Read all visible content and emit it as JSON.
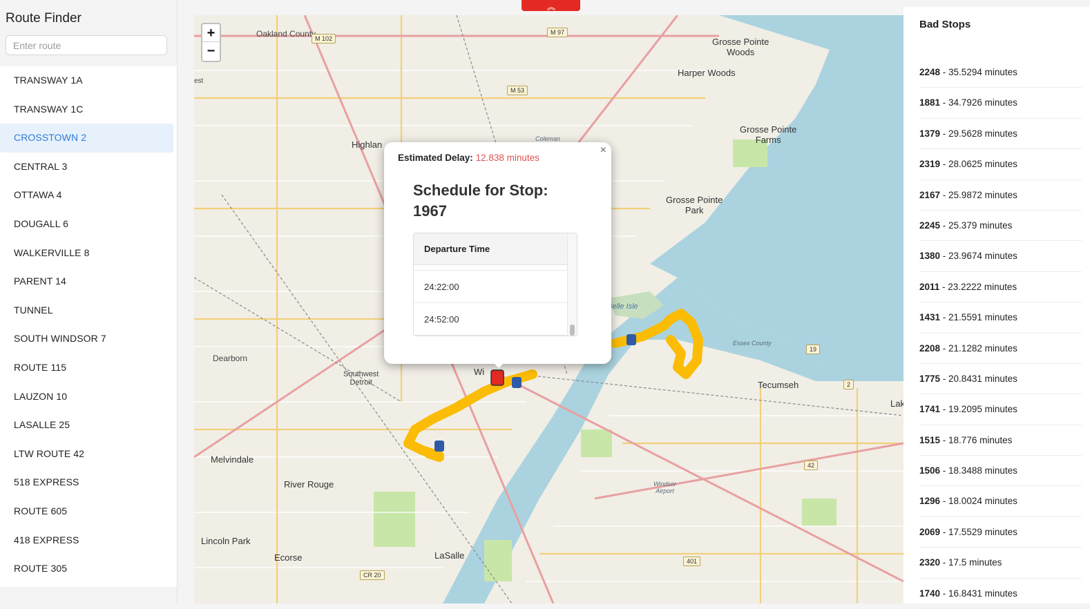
{
  "sidebar": {
    "title": "Route Finder",
    "search_placeholder": "Enter route",
    "routes": [
      {
        "label": "TRANSWAY 1A",
        "active": false
      },
      {
        "label": "TRANSWAY 1C",
        "active": false
      },
      {
        "label": "CROSSTOWN 2",
        "active": true
      },
      {
        "label": "CENTRAL 3",
        "active": false
      },
      {
        "label": "OTTAWA 4",
        "active": false
      },
      {
        "label": "DOUGALL 6",
        "active": false
      },
      {
        "label": "WALKERVILLE 8",
        "active": false
      },
      {
        "label": "PARENT 14",
        "active": false
      },
      {
        "label": "TUNNEL",
        "active": false
      },
      {
        "label": "SOUTH WINDSOR 7",
        "active": false
      },
      {
        "label": "ROUTE 115",
        "active": false
      },
      {
        "label": "LAUZON 10",
        "active": false
      },
      {
        "label": "LASALLE 25",
        "active": false
      },
      {
        "label": "LTW ROUTE 42",
        "active": false
      },
      {
        "label": "518 EXPRESS",
        "active": false
      },
      {
        "label": "ROUTE 605",
        "active": false
      },
      {
        "label": "418 EXPRESS",
        "active": false
      },
      {
        "label": "ROUTE 305",
        "active": false
      }
    ]
  },
  "map": {
    "zoom_in": "+",
    "zoom_out": "−",
    "labels": {
      "oakland": "Oakland County",
      "grosse_pointe_woods": "Grosse Pointe\nWoods",
      "harper_woods": "Harper Woods",
      "grosse_pointe_farms": "Grosse Pointe\nFarms",
      "grosse_pointe_park": "Grosse Pointe\nPark",
      "highland_park": "Highlan",
      "coleman": "Coleman",
      "belle_isle": "Belle Isle",
      "dearborn": "Dearborn",
      "southwest_detroit": "Southwest\nDetroit",
      "melvindale": "Melvindale",
      "river_rouge": "River Rouge",
      "lincoln_park": "Lincoln Park",
      "ecorse": "Ecorse",
      "lasalle": "LaSalle",
      "tecumseh": "Tecumseh",
      "windsor_airport": "Windsor\nAirport",
      "windsor_partial": "Wi",
      "essex_county": "Essex County",
      "lake_partial": "Lak",
      "est_partial": "est"
    },
    "shields": [
      "M 102",
      "M 97",
      "M 53",
      "42",
      "401",
      "19",
      "2",
      "CR 20"
    ],
    "route_color": "#fbbc05"
  },
  "popup": {
    "delay_label": "Estimated Delay:",
    "delay_value": "12.838 minutes",
    "title": "Schedule for Stop: 1967",
    "column_header": "Departure Time",
    "times": [
      "24:22:00",
      "24:52:00"
    ],
    "close": "×"
  },
  "top_tab_icon": "bus-icon",
  "bad_stops": {
    "title": "Bad Stops",
    "items": [
      {
        "id": "2248",
        "text": " - 35.5294 minutes"
      },
      {
        "id": "1881",
        "text": " - 34.7926 minutes"
      },
      {
        "id": "1379",
        "text": " - 29.5628 minutes"
      },
      {
        "id": "2319",
        "text": " - 28.0625 minutes"
      },
      {
        "id": "2167",
        "text": " - 25.9872 minutes"
      },
      {
        "id": "2245",
        "text": " - 25.379 minutes"
      },
      {
        "id": "1380",
        "text": " - 23.9674 minutes"
      },
      {
        "id": "2011",
        "text": " - 23.2222 minutes"
      },
      {
        "id": "1431",
        "text": " - 21.5591 minutes"
      },
      {
        "id": "2208",
        "text": " - 21.1282 minutes"
      },
      {
        "id": "1775",
        "text": " - 20.8431 minutes"
      },
      {
        "id": "1741",
        "text": " - 19.2095 minutes"
      },
      {
        "id": "1515",
        "text": " - 18.776 minutes"
      },
      {
        "id": "1506",
        "text": " - 18.3488 minutes"
      },
      {
        "id": "1296",
        "text": " - 18.0024 minutes"
      },
      {
        "id": "2069",
        "text": " - 17.5529 minutes"
      },
      {
        "id": "2320",
        "text": " - 17.5 minutes"
      },
      {
        "id": "1740",
        "text": " - 16.8431 minutes"
      }
    ]
  }
}
